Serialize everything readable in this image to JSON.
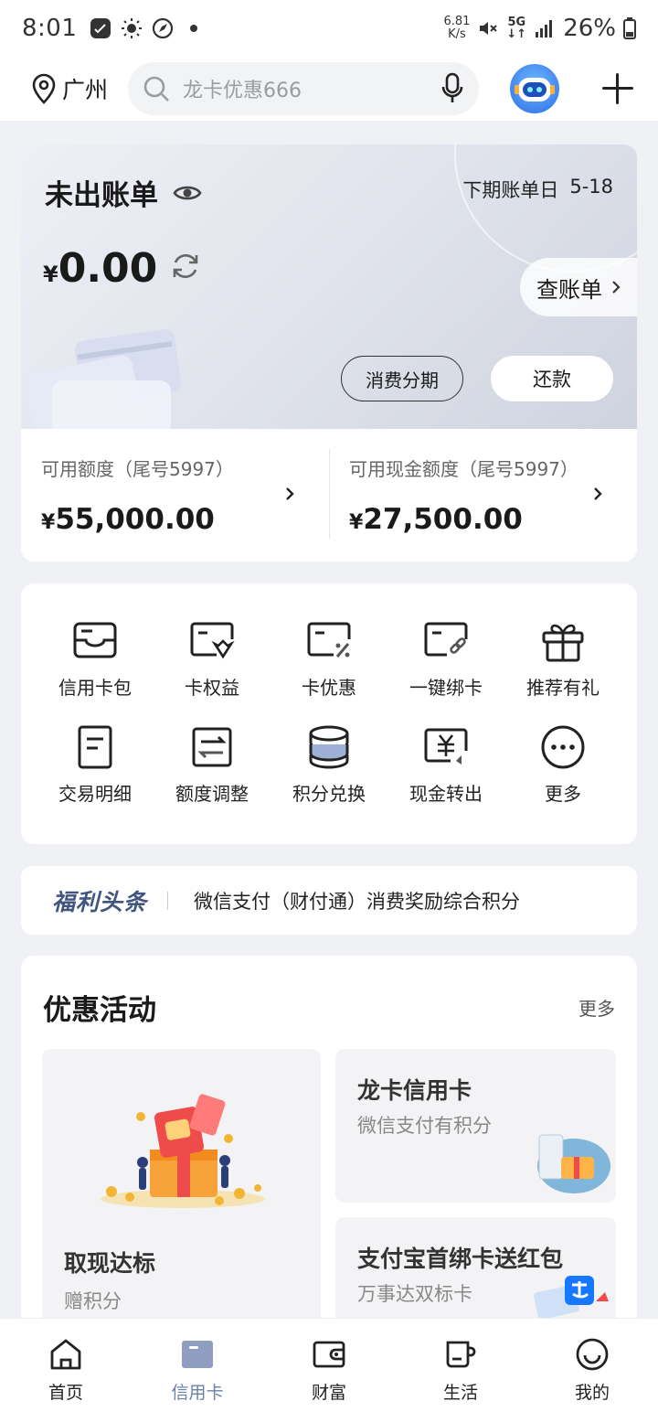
{
  "status_bar": {
    "time": "8:01",
    "net_speed_value": "6.81",
    "net_speed_unit": "K/s",
    "network": "5G",
    "battery": "26%"
  },
  "header": {
    "city": "广州",
    "search_placeholder": "龙卡优惠666"
  },
  "bill": {
    "title": "未出账单",
    "next_bill_label": "下期账单日",
    "next_bill_date": "5-18",
    "currency": "¥",
    "amount": "0.00",
    "check_bill_label": "查账单",
    "installment_label": "消费分期",
    "repay_label": "还款"
  },
  "credit": {
    "available_label": "可用额度（尾号5997）",
    "available_currency": "¥",
    "available_value": "55,000.00",
    "cash_label": "可用现金额度（尾号5997）",
    "cash_currency": "¥",
    "cash_value": "27,500.00"
  },
  "quick_actions": {
    "row1": [
      {
        "label": "信用卡包",
        "icon": "card-wallet-icon"
      },
      {
        "label": "卡权益",
        "icon": "card-rights-icon"
      },
      {
        "label": "卡优惠",
        "icon": "card-discount-icon"
      },
      {
        "label": "一键绑卡",
        "icon": "card-link-icon"
      },
      {
        "label": "推荐有礼",
        "icon": "gift-icon"
      }
    ],
    "row2": [
      {
        "label": "交易明细",
        "icon": "document-icon"
      },
      {
        "label": "额度调整",
        "icon": "adjust-icon"
      },
      {
        "label": "积分兑换",
        "icon": "coins-icon"
      },
      {
        "label": "现金转出",
        "icon": "cash-out-icon"
      },
      {
        "label": "更多",
        "icon": "more-icon"
      }
    ]
  },
  "news": {
    "tag": "福利头条",
    "text": "微信支付（财付通）消费奖励综合积分"
  },
  "promotions": {
    "title": "优惠活动",
    "more_label": "更多",
    "items": [
      {
        "title": "取现达标",
        "subtitle": "赠积分"
      },
      {
        "title": "龙卡信用卡",
        "subtitle": "微信支付有积分"
      },
      {
        "title": "支付宝首绑卡送红包",
        "subtitle": "万事达双标卡"
      }
    ]
  },
  "tab_bar": {
    "tabs": [
      {
        "label": "首页",
        "icon": "home-icon"
      },
      {
        "label": "信用卡",
        "icon": "credit-card-icon"
      },
      {
        "label": "财富",
        "icon": "wallet-icon"
      },
      {
        "label": "生活",
        "icon": "cup-icon"
      },
      {
        "label": "我的",
        "icon": "smile-icon"
      }
    ],
    "active_index": 1
  },
  "colors": {
    "accent_tab": "#6d7fa8",
    "news_tag": "#41557f",
    "page_bg": "#f0f1f5"
  }
}
